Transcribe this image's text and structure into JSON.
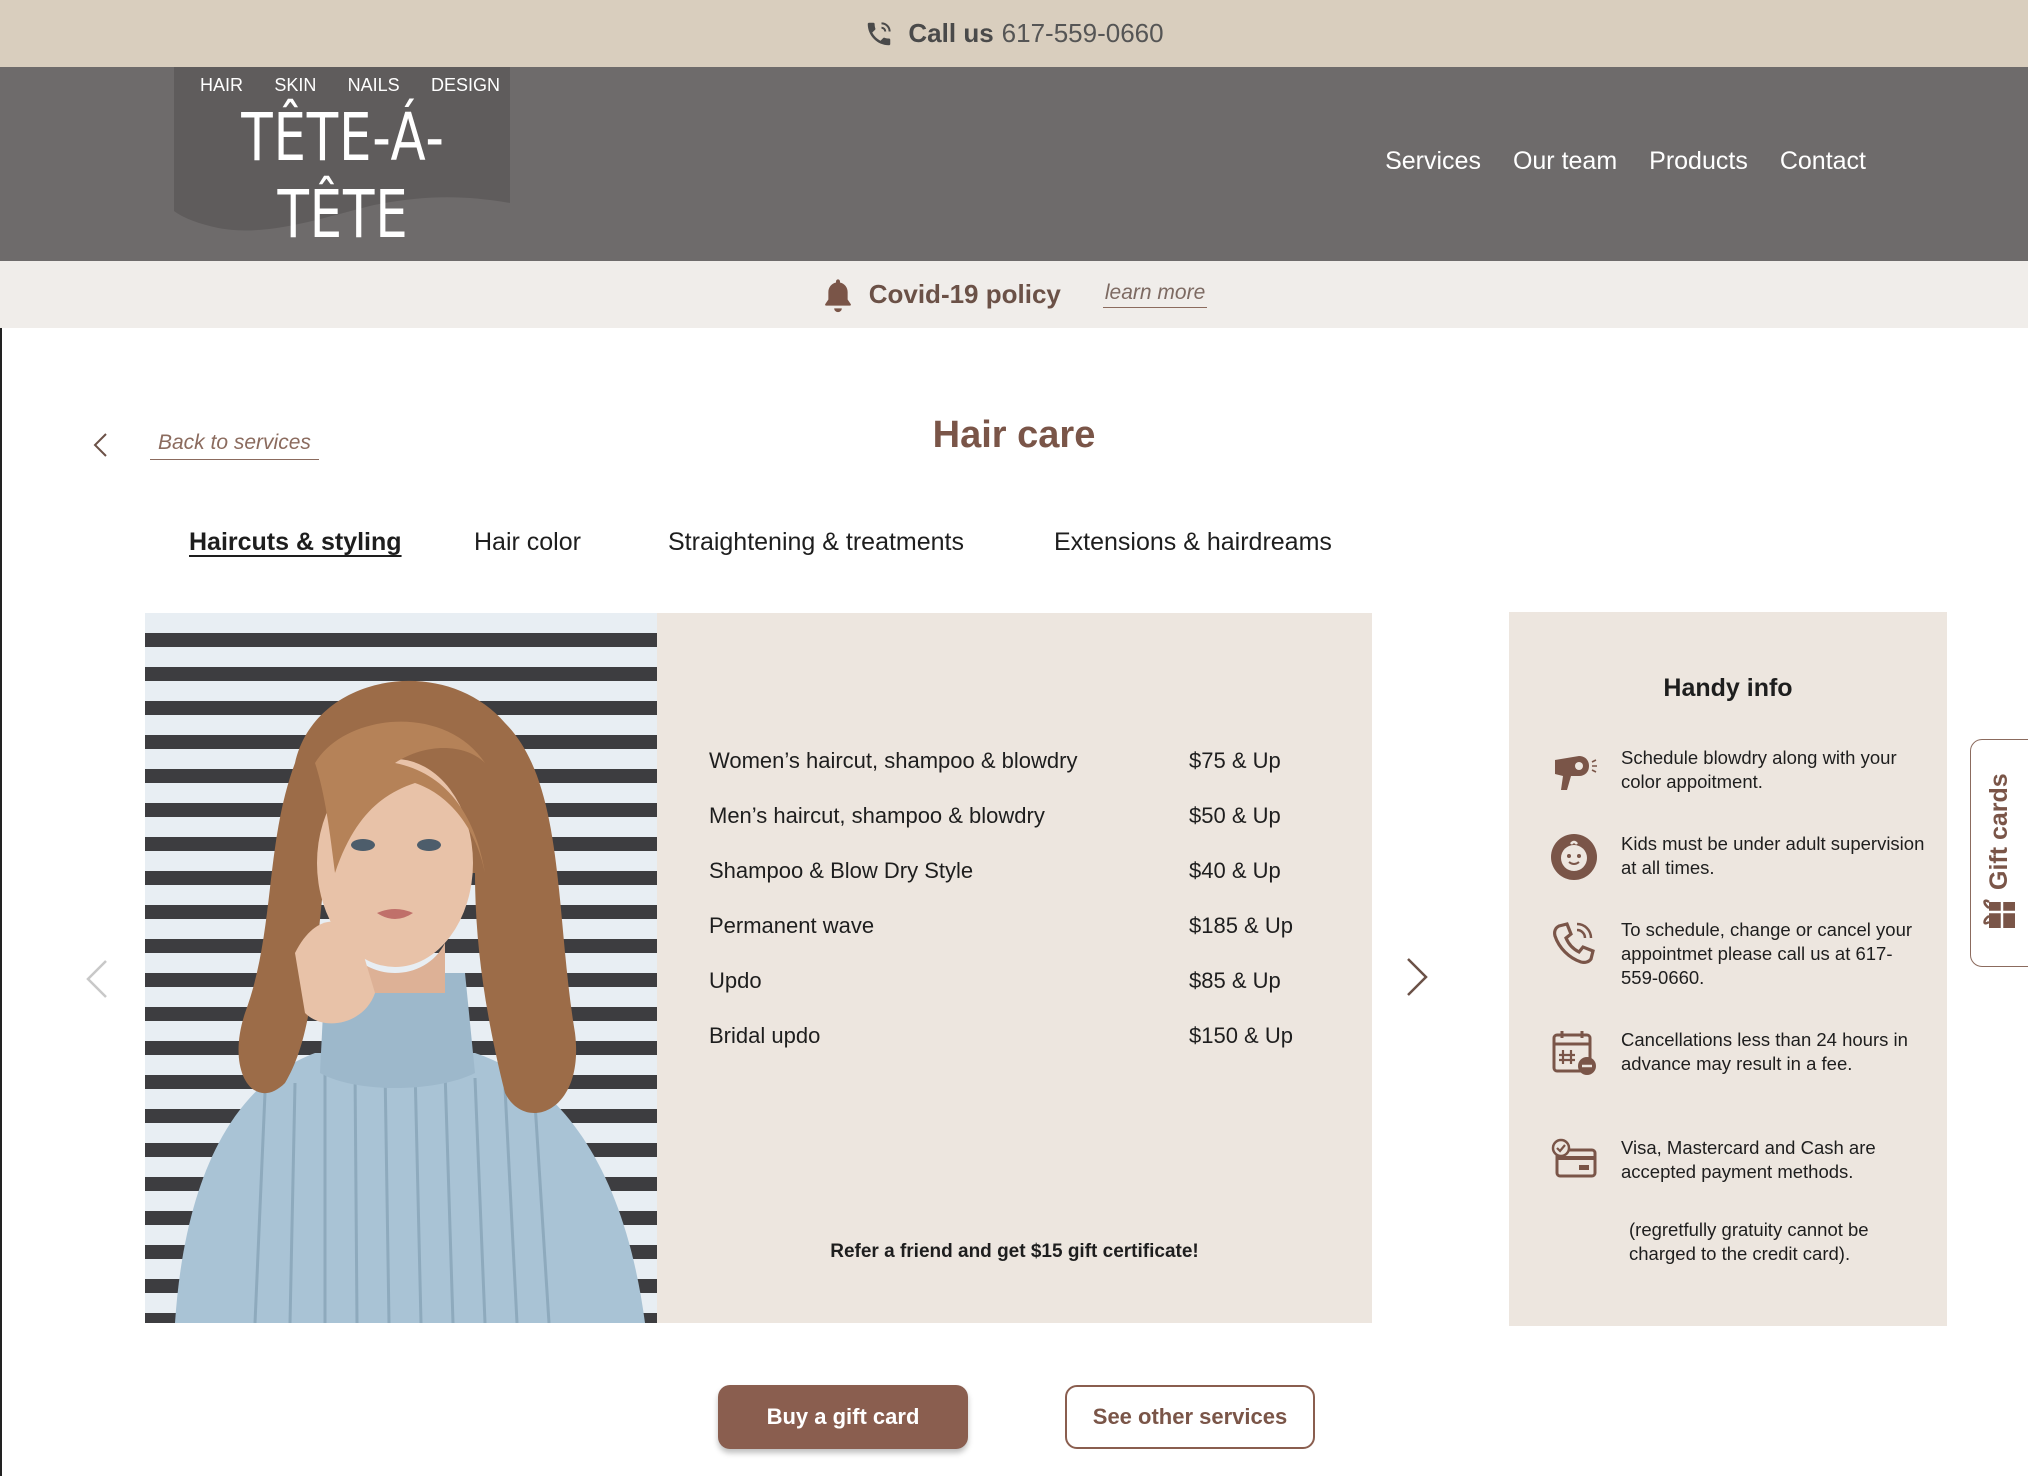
{
  "topbar": {
    "call_label": "Call us",
    "phone": "617-559-0660"
  },
  "brand": {
    "tagline": [
      "HAIR",
      "SKIN",
      "NAILS",
      "DESIGN"
    ],
    "wordmark": "TÊTE-Á-TÊTE"
  },
  "nav": {
    "items": [
      "Services",
      "Our team",
      "Products",
      "Contact"
    ]
  },
  "covid": {
    "title": "Covid-19 policy",
    "link": "learn more"
  },
  "page": {
    "back_label": "Back to services",
    "title": "Hair care"
  },
  "tabs": [
    {
      "label": "Haircuts & styling",
      "active": true
    },
    {
      "label": "Hair color",
      "active": false
    },
    {
      "label": "Straightening & treatments",
      "active": false
    },
    {
      "label": "Extensions & hairdreams",
      "active": false
    }
  ],
  "services": [
    {
      "name": "Women’s haircut, shampoo & blowdry",
      "price": "$75 & Up"
    },
    {
      "name": "Men’s haircut, shampoo & blowdry",
      "price": "$50 & Up"
    },
    {
      "name": "Shampoo & Blow Dry Style",
      "price": "$40 & Up"
    },
    {
      "name": "Permanent wave",
      "price": "$185 & Up"
    },
    {
      "name": "Updo",
      "price": "$85 & Up"
    },
    {
      "name": "Bridal updo",
      "price": "$150 & Up"
    }
  ],
  "refer_text": "Refer a friend and get $15 gift certificate!",
  "handy": {
    "title": "Handy info",
    "items": [
      {
        "icon": "hair-dryer-icon",
        "text": "Schedule blowdry along with your color appoitment."
      },
      {
        "icon": "child-face-icon",
        "text": "Kids must be under adult supervision at all times."
      },
      {
        "icon": "phone-icon",
        "text": "To schedule, change or cancel your appointmet please call us at 617-559-0660."
      },
      {
        "icon": "calendar-cancel-icon",
        "text": "Cancellations less than 24 hours in advance may result in a fee."
      },
      {
        "icon": "credit-card-icon",
        "text": "Visa, Mastercard and Cash are accepted payment methods."
      }
    ],
    "note": "(regretfully gratuity cannot be charged to the credit card)."
  },
  "gift_tab": "Gift cards",
  "buttons": {
    "buy_gift": "Buy a gift card",
    "other_services": "See other services"
  },
  "colors": {
    "accent": "#8a5e4f",
    "topbar": "#d9cebe",
    "header": "#6e6b6b",
    "panel": "#ede6df"
  }
}
